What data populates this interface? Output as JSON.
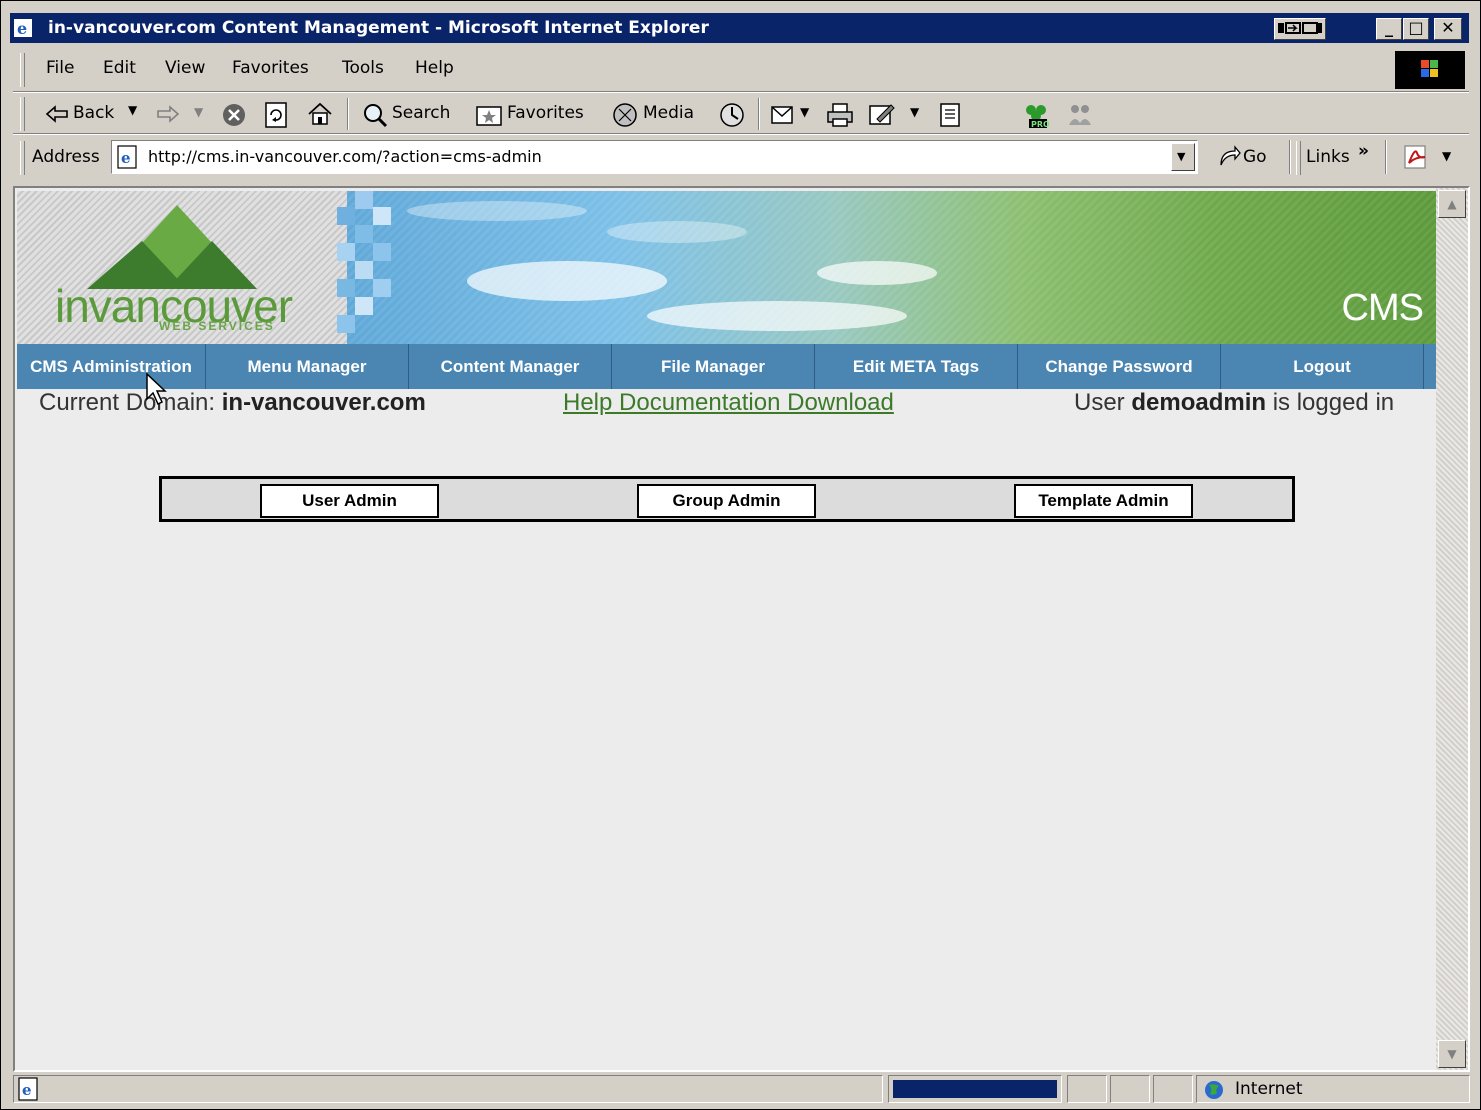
{
  "window": {
    "title": "in-vancouver.com Content Management - Microsoft Internet Explorer",
    "minimize": "_",
    "maximize": "□",
    "close": "✕"
  },
  "menubar": [
    "File",
    "Edit",
    "View",
    "Favorites",
    "Tools",
    "Help"
  ],
  "toolbar": {
    "back": "Back",
    "search": "Search",
    "favorites": "Favorites",
    "media": "Media"
  },
  "address": {
    "label": "Address",
    "url": "http://cms.in-vancouver.com/?action=cms-admin",
    "go": "Go",
    "links": "Links",
    "links_chevron": "»"
  },
  "banner": {
    "logo_word": "invancouver",
    "logo_sub": "WEB SERVICES",
    "cms_label": "CMS"
  },
  "nav": [
    "CMS Administration",
    "Menu Manager",
    "Content Manager",
    "File Manager",
    "Edit META Tags",
    "Change Password",
    "Logout"
  ],
  "info": {
    "domain_prefix": "Current Domain: ",
    "domain": "in-vancouver.com",
    "help_link": "Help Documentation Download",
    "user_prefix": "User ",
    "user": "demoadmin",
    "user_suffix": " is logged in"
  },
  "admin_buttons": [
    "User Admin",
    "Group Admin",
    "Template Admin"
  ],
  "status": {
    "zone": "Internet"
  },
  "colors": {
    "titlebar": "#0a246a",
    "nav": "#4b85b2",
    "link": "#3c7a2a"
  }
}
